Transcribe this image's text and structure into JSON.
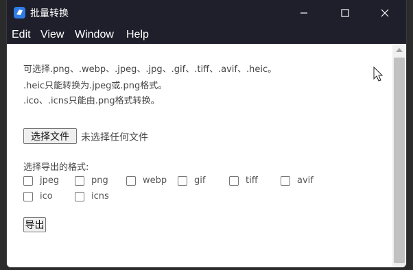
{
  "window": {
    "title": "批量转换",
    "brand_color": "#2f7ce8"
  },
  "menu": {
    "items": [
      "Edit",
      "View",
      "Window",
      "Help"
    ]
  },
  "info": {
    "line1": "可选择.png、.webp、.jpeg、.jpg、.gif、.tiff、.avif、.heic。",
    "line2": ".heic只能转换为.jpeg或.png格式。",
    "line3": ".ico、.icns只能由.png格式转换。"
  },
  "file": {
    "button_label": "选择文件",
    "status": "未选择任何文件"
  },
  "formats": {
    "label": "选择导出的格式:",
    "options": [
      {
        "label": "jpeg",
        "checked": false
      },
      {
        "label": "png",
        "checked": false
      },
      {
        "label": "webp",
        "checked": false
      },
      {
        "label": "gif",
        "checked": false
      },
      {
        "label": "tiff",
        "checked": false
      },
      {
        "label": "avif",
        "checked": false
      },
      {
        "label": "ico",
        "checked": false
      },
      {
        "label": "icns",
        "checked": false
      }
    ]
  },
  "export": {
    "button_label": "导出"
  },
  "icons": {
    "app": "app-logo-icon",
    "minimize": "minimize-icon",
    "maximize": "maximize-icon",
    "close": "close-icon",
    "cursor": "mouse-cursor-icon"
  }
}
